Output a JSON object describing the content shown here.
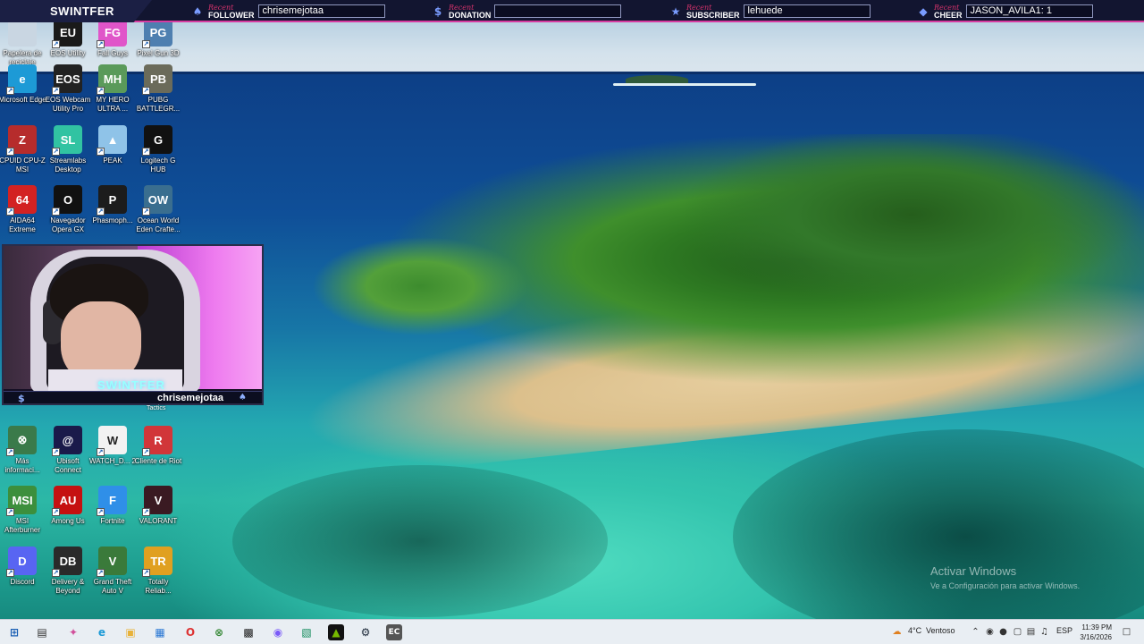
{
  "overlay": {
    "brand": "SWINTFER",
    "follower": {
      "recent": "Recent",
      "kind": "FOLLOWER",
      "value": "chrisemejotaa"
    },
    "donation": {
      "recent": "Recent",
      "kind": "DONATION",
      "value": ""
    },
    "subscriber": {
      "recent": "Recent",
      "kind": "SUBSCRIBER",
      "value": "lehuede"
    },
    "cheer": {
      "recent": "Recent",
      "kind": "CHEER",
      "value": "JASON_AVILA1: 1"
    }
  },
  "desktop_icons": [
    {
      "label": "Papelera de reciclaje",
      "icon": "recycle-bin-icon",
      "color": "#c9d6e2",
      "glyph": ""
    },
    {
      "label": "EOS Utility",
      "icon": "eos-utility-icon",
      "color": "#1a1a1a",
      "glyph": "EU"
    },
    {
      "label": "Fall Guys",
      "icon": "fall-guys-icon",
      "color": "#e055c9",
      "glyph": "FG"
    },
    {
      "label": "Pixel Gun 3D",
      "icon": "pixel-gun-icon",
      "color": "#4e7fb0",
      "glyph": "PG"
    },
    {
      "label": "Microsoft Edge",
      "icon": "edge-icon",
      "color": "#1d9ad6",
      "glyph": "e"
    },
    {
      "label": "EOS Webcam Utility Pro",
      "icon": "eos-webcam-icon",
      "color": "#222222",
      "glyph": "EOS"
    },
    {
      "label": "MY HERO ULTRA ...",
      "icon": "my-hero-icon",
      "color": "#5a9a5a",
      "glyph": "MH"
    },
    {
      "label": "PUBG BATTLEGR...",
      "icon": "pubg-icon",
      "color": "#6b6b5a",
      "glyph": "PB"
    },
    {
      "label": "CPUID CPU-Z MSI",
      "icon": "cpuz-icon",
      "color": "#b62c2c",
      "glyph": "Z"
    },
    {
      "label": "Streamlabs Desktop",
      "icon": "streamlabs-icon",
      "color": "#31c3a2",
      "glyph": "SL"
    },
    {
      "label": "PEAK",
      "icon": "peak-icon",
      "color": "#8fc3e8",
      "glyph": "▲"
    },
    {
      "label": "Logitech G HUB",
      "icon": "logitech-icon",
      "color": "#111111",
      "glyph": "G"
    },
    {
      "label": "AIDA64 Extreme",
      "icon": "aida64-icon",
      "color": "#d32222",
      "glyph": "64"
    },
    {
      "label": "Navegador Opera GX",
      "icon": "opera-gx-icon",
      "color": "#111111",
      "glyph": "O"
    },
    {
      "label": "Phasmoph...",
      "icon": "phasmophobia-icon",
      "color": "#1c1c1c",
      "glyph": "P"
    },
    {
      "label": "Ocean World Eden Crafte...",
      "icon": "ocean-world-icon",
      "color": "#3a6e8f",
      "glyph": "OW"
    },
    {
      "label": "Más informaci...",
      "icon": "xbox-icon",
      "color": "#3a7a4a",
      "glyph": "⊗"
    },
    {
      "label": "Ubisoft Connect",
      "icon": "ubisoft-icon",
      "color": "#1a1a4a",
      "glyph": "@"
    },
    {
      "label": "WATCH_D... 2",
      "icon": "watch-dogs-icon",
      "color": "#f2f2f2",
      "glyph": "W"
    },
    {
      "label": "Cliente de Riot",
      "icon": "riot-icon",
      "color": "#d13639",
      "glyph": "R"
    },
    {
      "label": "MSI Afterburner",
      "icon": "msi-afterburner-icon",
      "color": "#3c8f3c",
      "glyph": "MSI"
    },
    {
      "label": "Among Us",
      "icon": "among-us-icon",
      "color": "#c51111",
      "glyph": "AU"
    },
    {
      "label": "Fortnite",
      "icon": "fortnite-icon",
      "color": "#2f8fe8",
      "glyph": "F"
    },
    {
      "label": "VALORANT",
      "icon": "valorant-icon",
      "color": "#3a1a22",
      "glyph": "V"
    },
    {
      "label": "Discord",
      "icon": "discord-icon",
      "color": "#5865f2",
      "glyph": "D"
    },
    {
      "label": "Delivery & Beyond",
      "icon": "delivery-icon",
      "color": "#2a2a2a",
      "glyph": "DB"
    },
    {
      "label": "Grand Theft Auto V",
      "icon": "gta-icon",
      "color": "#3a7a3a",
      "glyph": "V"
    },
    {
      "label": "Totally Reliab...",
      "icon": "totally-reliable-icon",
      "color": "#e0a020",
      "glyph": "TR"
    }
  ],
  "webcam": {
    "logo": "SWINTFER",
    "name": "chrisemejotaa",
    "partial_label": "Tactics"
  },
  "watermark": {
    "title": "Activar Windows",
    "subtitle": "Ve a Configuración para activar Windows."
  },
  "taskbar": {
    "weather": "4°C",
    "weather_desc": "Ventoso",
    "language": "ESP",
    "time": "11:39 PM",
    "date": "3/16/2026"
  }
}
